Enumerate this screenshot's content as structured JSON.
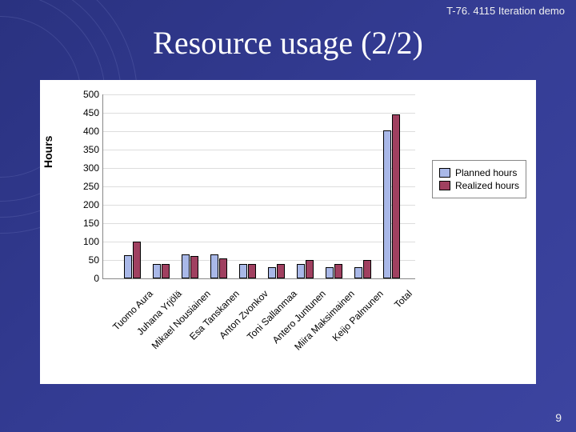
{
  "header": {
    "small_label": "T-76. 4115 Iteration demo",
    "title": "Resource usage (2/2)"
  },
  "page_number": "9",
  "chart_data": {
    "type": "bar",
    "ylabel": "Hours",
    "ylim": [
      0,
      500
    ],
    "ystep": 50,
    "categories": [
      "Tuomo Aura",
      "Juhana Yrjölä",
      "Mikael Nousiainen",
      "Esa Tanskanen",
      "Anton Zvonkov",
      "Toni Sallanmaa",
      "Antero Juntunen",
      "Miira Maksimainen",
      "Keijo Palmunen",
      "Total"
    ],
    "series": [
      {
        "name": "Planned hours",
        "values": [
          62,
          40,
          65,
          65,
          40,
          30,
          40,
          30,
          30,
          402
        ]
      },
      {
        "name": "Realized hours",
        "values": [
          100,
          40,
          60,
          55,
          40,
          40,
          50,
          40,
          50,
          445
        ]
      }
    ]
  },
  "legend": {
    "items": [
      "Planned hours",
      "Realized hours"
    ]
  }
}
